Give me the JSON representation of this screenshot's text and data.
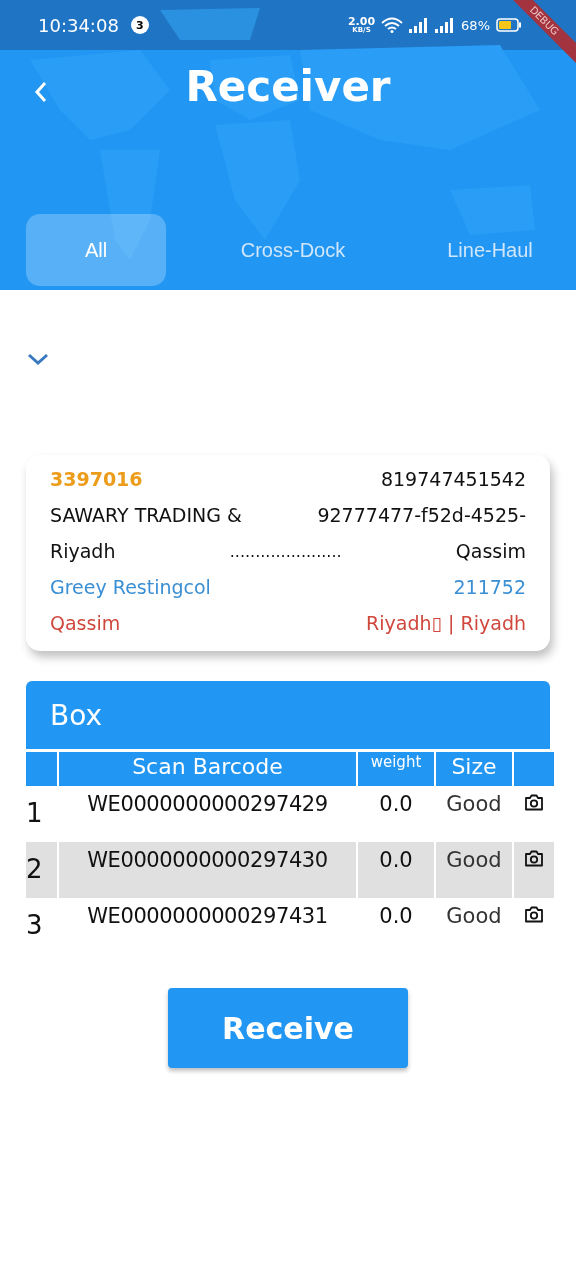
{
  "status_bar": {
    "time": "10:34:08",
    "notification_count": "3",
    "speed": "2.00",
    "speed_unit": "KB/S",
    "battery": "68%"
  },
  "debug_banner": "DEBUG",
  "header": {
    "title": "Receiver"
  },
  "tabs": [
    {
      "label": "All",
      "selected": true
    },
    {
      "label": "Cross-Dock",
      "selected": false
    },
    {
      "label": "Line-Haul",
      "selected": false
    }
  ],
  "shipment": {
    "order_id": "3397016",
    "tracking": "819747451542",
    "company": "SAWARY TRADING &",
    "reference": "92777477-f52d-4525-",
    "origin": "Riyadh",
    "dots": "......................",
    "destination": "Qassim",
    "contact": "Greey Restingcol",
    "code": "211752",
    "from_city": "Qassim",
    "to_city": "Riyadh▯ | Riyadh"
  },
  "box_table": {
    "title": "Box",
    "columns": [
      "Scan Barcode",
      "weight",
      "Size"
    ],
    "rows": [
      {
        "index": "1",
        "barcode": "WE0000000000297429",
        "weight": "0.0",
        "size": "Good"
      },
      {
        "index": "2",
        "barcode": "WE0000000000297430",
        "weight": "0.0",
        "size": "Good"
      },
      {
        "index": "3",
        "barcode": "WE0000000000297431",
        "weight": "0.0",
        "size": "Good"
      }
    ]
  },
  "receive_button": "Receive"
}
